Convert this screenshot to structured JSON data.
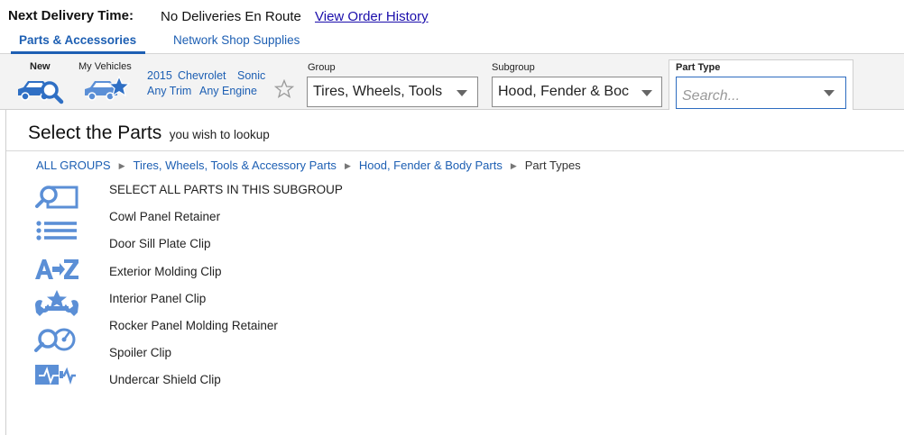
{
  "header": {
    "next_delivery_label": "Next Delivery Time:",
    "next_delivery_value": "No Deliveries En Route",
    "order_history_link": "View Order History"
  },
  "tabs": [
    {
      "label": "Parts & Accessories",
      "active": true
    },
    {
      "label": "Network Shop Supplies",
      "active": false
    }
  ],
  "vehicle": {
    "new_label": "New",
    "my_vehicles_label": "My Vehicles",
    "year": "2015",
    "make": "Chevrolet",
    "model": "Sonic",
    "trim": "Any Trim",
    "engine": "Any Engine"
  },
  "filters": {
    "group_label": "Group",
    "group_value": "Tires, Wheels, Tools",
    "subgroup_label": "Subgroup",
    "subgroup_value": "Hood, Fender & Boc",
    "part_type_label": "Part Type",
    "part_type_placeholder": "Search..."
  },
  "page": {
    "title": "Select the Parts",
    "subtitle": "you wish to lookup"
  },
  "breadcrumb": {
    "items": [
      "ALL GROUPS",
      "Tires, Wheels, Tools & Accessory Parts",
      "Hood, Fender & Body Parts"
    ],
    "current": "Part Types",
    "separator": "▶"
  },
  "parts": [
    "SELECT ALL PARTS IN THIS SUBGROUP",
    "Cowl Panel Retainer",
    "Door Sill Plate Clip",
    "Exterior Molding Clip",
    "Interior Panel Clip",
    "Rocker Panel Molding Retainer",
    "Spoiler Clip",
    "Undercar Shield Clip"
  ],
  "side_icons": [
    "search-panel-icon",
    "list-icon",
    "a-to-z-icon",
    "wrench-star-icon",
    "search-gauge-icon",
    "battery-pulse-icon"
  ],
  "colors": {
    "link": "#1d5fb3",
    "icon": "#5b8fd6",
    "accent": "#1d5fb3"
  }
}
